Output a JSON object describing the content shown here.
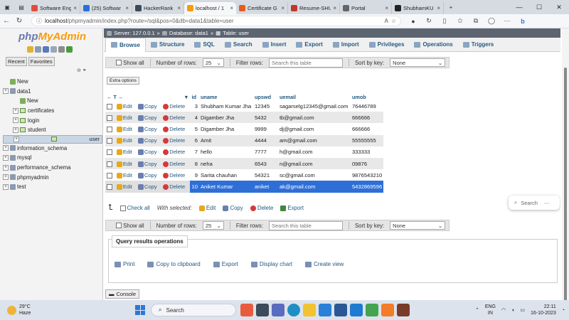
{
  "browser": {
    "tabs": [
      {
        "label": "Software Eng",
        "color": "#e04b3c"
      },
      {
        "label": "(25) Softwar",
        "color": "#2a6fd6"
      },
      {
        "label": "HackerRank",
        "color": "#3b4a5a"
      },
      {
        "label": "localhost / 1",
        "color": "#f89c0e",
        "active": true
      },
      {
        "label": "Certificate G",
        "color": "#e25d22"
      },
      {
        "label": "Resume-SHU",
        "color": "#c0392b"
      },
      {
        "label": "Portal",
        "color": "#666666"
      },
      {
        "label": "ShubhamKU",
        "color": "#222222"
      }
    ],
    "url_host": "localhost",
    "url_path": "/phpmyadmin/index.php?route=/sql&pos=0&db=data1&table=user"
  },
  "nav": {
    "logo_php": "php",
    "logo_ma": "MyAdmin",
    "tab_recent": "Recent",
    "tab_favorites": "Favorites",
    "tree": [
      {
        "label": "New",
        "level": 0
      },
      {
        "label": "data1",
        "level": 0
      },
      {
        "label": "New",
        "level": 1
      },
      {
        "label": "certificates",
        "level": 1
      },
      {
        "label": "login",
        "level": 1
      },
      {
        "label": "student",
        "level": 1
      },
      {
        "label": "user",
        "level": 1,
        "selected": true
      },
      {
        "label": "information_schema",
        "level": 0
      },
      {
        "label": "mysql",
        "level": 0
      },
      {
        "label": "performance_schema",
        "level": 0
      },
      {
        "label": "phpmyadmin",
        "level": 0
      },
      {
        "label": "test",
        "level": 0
      }
    ]
  },
  "breadcrumb": {
    "server": "Server: 127.0.0.1",
    "database": "Database: data1",
    "table": "Table: user"
  },
  "menu": [
    "Browse",
    "Structure",
    "SQL",
    "Search",
    "Insert",
    "Export",
    "Import",
    "Privileges",
    "Operations",
    "Triggers"
  ],
  "navrow": {
    "show_all": "Show all",
    "rows_label": "Number of rows:",
    "rows_value": "25",
    "filter_label": "Filter rows:",
    "filter_placeholder": "Search this table",
    "sort_label": "Sort by key:",
    "sort_value": "None"
  },
  "extra_options": "Extra options",
  "table": {
    "headers": [
      "id",
      "uname",
      "upswd",
      "uemail",
      "umob"
    ],
    "actions": {
      "edit": "Edit",
      "copy": "Copy",
      "delete": "Delete"
    },
    "rows": [
      [
        "3",
        "Shubham Kumar Jha",
        "12345",
        "sagarselg12345@gmail.com",
        "76446789"
      ],
      [
        "4",
        "Digamber Jha",
        "5432",
        "tb@gmail.com",
        "666666"
      ],
      [
        "5",
        "Digamber Jha",
        "9999",
        "dj@gmail.com",
        "666666"
      ],
      [
        "6",
        "Amit",
        "4444",
        "am@gmail.com",
        "55555555"
      ],
      [
        "7",
        "hello",
        "7777",
        "h@gmail.com",
        "333333"
      ],
      [
        "8",
        "neha",
        "6543",
        "n@gmail.com",
        "09876"
      ],
      [
        "9",
        "Sarita chauhan",
        "54321",
        "sc@gmail.com",
        "9876543210"
      ],
      [
        "10",
        "Aniket Kumar",
        "aniket",
        "ak@gmail.com",
        "5432869596"
      ]
    ]
  },
  "with_selected": {
    "check_all": "Check all",
    "label": "With selected:",
    "edit": "Edit",
    "copy": "Copy",
    "delete": "Delete",
    "export": "Export"
  },
  "query_ops": {
    "title": "Query results operations",
    "items": [
      "Print",
      "Copy to clipboard",
      "Export",
      "Display chart",
      "Create view"
    ]
  },
  "console": "Console",
  "search_popup": "Search",
  "taskbar": {
    "temp": "29°C",
    "weather": "Haze",
    "search": "Search",
    "lang1": "ENG",
    "lang2": "IN",
    "time": "22:11",
    "date": "16-10-2023"
  }
}
